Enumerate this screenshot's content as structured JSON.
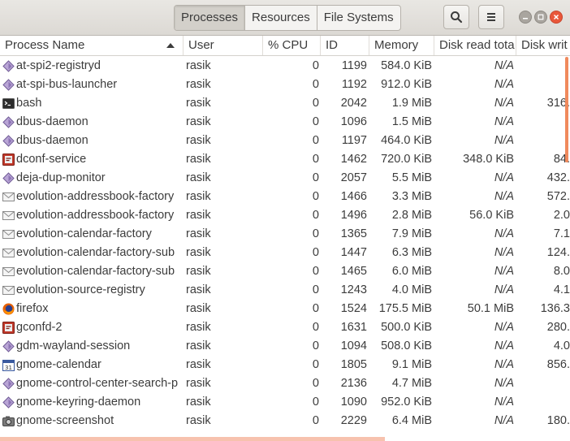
{
  "header": {
    "tabs": [
      {
        "label": "Processes"
      },
      {
        "label": "Resources"
      },
      {
        "label": "File Systems"
      }
    ],
    "search_icon": "search-icon",
    "menu_icon": "hamburger-menu-icon"
  },
  "columns": {
    "name": "Process Name",
    "user": "User",
    "cpu": "% CPU",
    "id": "ID",
    "memory": "Memory",
    "disk_read": "Disk read tota",
    "disk_write": "Disk writ"
  },
  "processes": [
    {
      "name": "at-spi2-registryd",
      "icon": "diamond-app-icon",
      "user": "rasik",
      "cpu": "0",
      "id": "1199",
      "memory": "584.0 KiB",
      "disk_read": "N/A",
      "disk_write": ""
    },
    {
      "name": "at-spi-bus-launcher",
      "icon": "diamond-app-icon",
      "user": "rasik",
      "cpu": "0",
      "id": "1192",
      "memory": "912.0 KiB",
      "disk_read": "N/A",
      "disk_write": ""
    },
    {
      "name": "bash",
      "icon": "terminal-icon",
      "user": "rasik",
      "cpu": "0",
      "id": "2042",
      "memory": "1.9 MiB",
      "disk_read": "N/A",
      "disk_write": "316."
    },
    {
      "name": "dbus-daemon",
      "icon": "diamond-app-icon",
      "user": "rasik",
      "cpu": "0",
      "id": "1096",
      "memory": "1.5 MiB",
      "disk_read": "N/A",
      "disk_write": ""
    },
    {
      "name": "dbus-daemon",
      "icon": "diamond-app-icon",
      "user": "rasik",
      "cpu": "0",
      "id": "1197",
      "memory": "464.0 KiB",
      "disk_read": "N/A",
      "disk_write": ""
    },
    {
      "name": "dconf-service",
      "icon": "dconf-icon",
      "user": "rasik",
      "cpu": "0",
      "id": "1462",
      "memory": "720.0 KiB",
      "disk_read": "348.0 KiB",
      "disk_write": "84."
    },
    {
      "name": "deja-dup-monitor",
      "icon": "diamond-app-icon",
      "user": "rasik",
      "cpu": "0",
      "id": "2057",
      "memory": "5.5 MiB",
      "disk_read": "N/A",
      "disk_write": "432."
    },
    {
      "name": "evolution-addressbook-factory",
      "icon": "envelope-icon",
      "user": "rasik",
      "cpu": "0",
      "id": "1466",
      "memory": "3.3 MiB",
      "disk_read": "N/A",
      "disk_write": "572."
    },
    {
      "name": "evolution-addressbook-factory",
      "icon": "envelope-icon",
      "user": "rasik",
      "cpu": "0",
      "id": "1496",
      "memory": "2.8 MiB",
      "disk_read": "56.0 KiB",
      "disk_write": "2.0"
    },
    {
      "name": "evolution-calendar-factory",
      "icon": "envelope-icon",
      "user": "rasik",
      "cpu": "0",
      "id": "1365",
      "memory": "7.9 MiB",
      "disk_read": "N/A",
      "disk_write": "7.1"
    },
    {
      "name": "evolution-calendar-factory-sub",
      "icon": "envelope-icon",
      "user": "rasik",
      "cpu": "0",
      "id": "1447",
      "memory": "6.3 MiB",
      "disk_read": "N/A",
      "disk_write": "124."
    },
    {
      "name": "evolution-calendar-factory-sub",
      "icon": "envelope-icon",
      "user": "rasik",
      "cpu": "0",
      "id": "1465",
      "memory": "6.0 MiB",
      "disk_read": "N/A",
      "disk_write": "8.0"
    },
    {
      "name": "evolution-source-registry",
      "icon": "envelope-icon",
      "user": "rasik",
      "cpu": "0",
      "id": "1243",
      "memory": "4.0 MiB",
      "disk_read": "N/A",
      "disk_write": "4.1"
    },
    {
      "name": "firefox",
      "icon": "firefox-icon",
      "user": "rasik",
      "cpu": "0",
      "id": "1524",
      "memory": "175.5 MiB",
      "disk_read": "50.1 MiB",
      "disk_write": "136.3"
    },
    {
      "name": "gconfd-2",
      "icon": "dconf-icon",
      "user": "rasik",
      "cpu": "0",
      "id": "1631",
      "memory": "500.0 KiB",
      "disk_read": "N/A",
      "disk_write": "280."
    },
    {
      "name": "gdm-wayland-session",
      "icon": "diamond-app-icon",
      "user": "rasik",
      "cpu": "0",
      "id": "1094",
      "memory": "508.0 KiB",
      "disk_read": "N/A",
      "disk_write": "4.0"
    },
    {
      "name": "gnome-calendar",
      "icon": "calendar-icon",
      "user": "rasik",
      "cpu": "0",
      "id": "1805",
      "memory": "9.1 MiB",
      "disk_read": "N/A",
      "disk_write": "856."
    },
    {
      "name": "gnome-control-center-search-p",
      "icon": "diamond-app-icon",
      "user": "rasik",
      "cpu": "0",
      "id": "2136",
      "memory": "4.7 MiB",
      "disk_read": "N/A",
      "disk_write": ""
    },
    {
      "name": "gnome-keyring-daemon",
      "icon": "diamond-app-icon",
      "user": "rasik",
      "cpu": "0",
      "id": "1090",
      "memory": "952.0 KiB",
      "disk_read": "N/A",
      "disk_write": ""
    },
    {
      "name": "gnome-screenshot",
      "icon": "camera-icon",
      "user": "rasik",
      "cpu": "0",
      "id": "2229",
      "memory": "6.4 MiB",
      "disk_read": "N/A",
      "disk_write": "180."
    }
  ],
  "colors": {
    "accent": "#e9573a",
    "scrollbar": "#f08a5d"
  }
}
